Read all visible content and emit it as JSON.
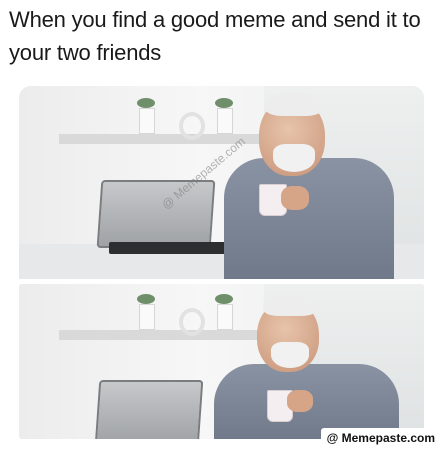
{
  "caption": "When you find a good meme and send it to your two friends",
  "watermark": "@ Memepaste.com",
  "credit": "@ Memepaste.com"
}
